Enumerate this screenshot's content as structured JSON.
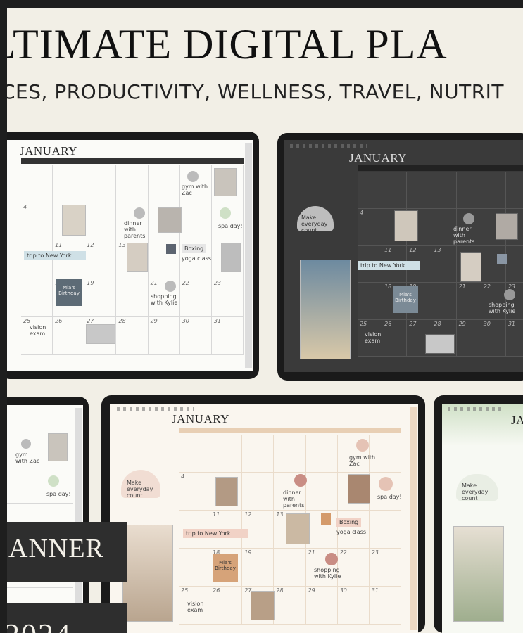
{
  "banner": {
    "title": "LTIMATE DIGITAL PLA",
    "subtitle": "CES, PRODUCTIVITY, WELLNESS, TRAVEL, NUTRIT"
  },
  "calendar": {
    "month": "JANUARY",
    "notes": {
      "trip": "trip to New York",
      "gym": "gym with Zac",
      "dinner": "dinner with parents",
      "spa": "spa day!",
      "boxing": "Boxing",
      "yoga": "yoga class",
      "mia": "Mia's Birthday",
      "shopping": "shopping with Kylie",
      "vision": "vision exam",
      "mantra": "Make everyday count"
    },
    "dates": {
      "d4": "4",
      "d11": "11",
      "d12": "12",
      "d13": "13",
      "d18": "18",
      "d19": "19",
      "d21": "21",
      "d22": "22",
      "d23": "23",
      "d25": "25",
      "d26": "26",
      "d27": "27",
      "d28": "28",
      "d29": "29",
      "d30": "30",
      "d31": "31"
    }
  },
  "overlay": {
    "planner": "ANNER",
    "year": "2024"
  },
  "colors": {
    "background": "#f2efe6",
    "dark_screen": "#3a3a3a",
    "beige_accent": "#e8cfb4",
    "green_accent": "#cfe0c6",
    "tag_blue": "#cfe0e6",
    "tag_pink": "#f1d2c6"
  }
}
